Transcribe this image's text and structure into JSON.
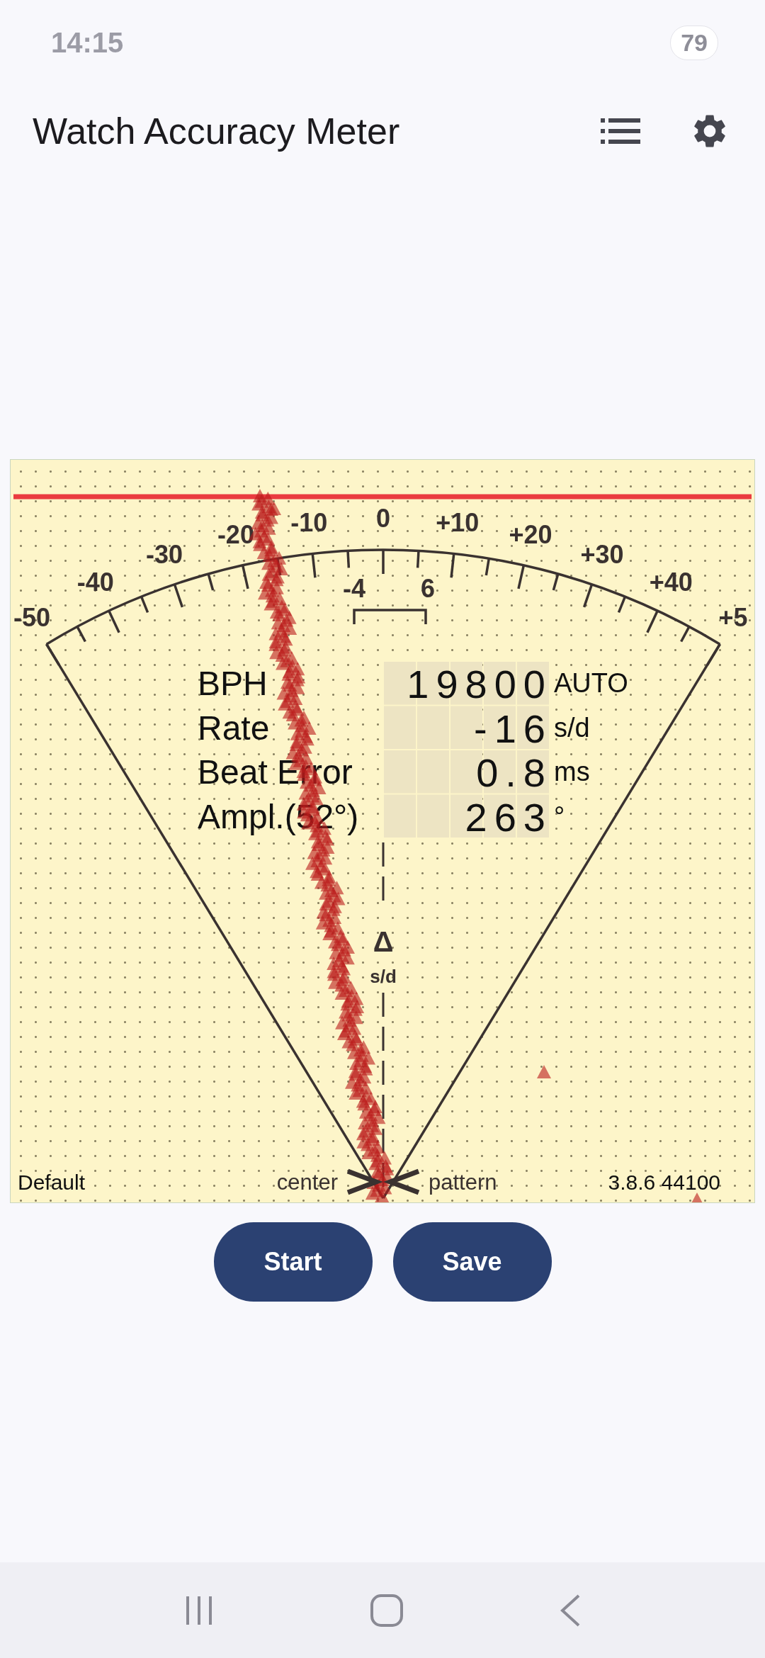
{
  "status_bar": {
    "time": "14:15",
    "battery": "79"
  },
  "app_bar": {
    "title": "Watch Accuracy Meter"
  },
  "meter": {
    "scale_labels": [
      "-50",
      "-40",
      "-30",
      "-20",
      "-10",
      "0",
      "+10",
      "+20",
      "+30",
      "+40",
      "+5"
    ],
    "tolerance_labels": [
      "-4",
      "6"
    ],
    "readouts": [
      {
        "label": "BPH",
        "value": "19800",
        "unit": "AUTO"
      },
      {
        "label": "Rate",
        "value": "-16",
        "unit": "s/d"
      },
      {
        "label": "Beat Error",
        "value": "0.8",
        "unit": "ms"
      },
      {
        "label": "Ampl.(52°)",
        "value": "263",
        "unit": "°"
      }
    ],
    "delta_symbol": "Δ",
    "delta_unit": "s/d",
    "profile": "Default",
    "center_label": "center",
    "pattern_label": "pattern",
    "version": "3.8.6 44100"
  },
  "buttons": [
    "Start",
    "Save"
  ]
}
